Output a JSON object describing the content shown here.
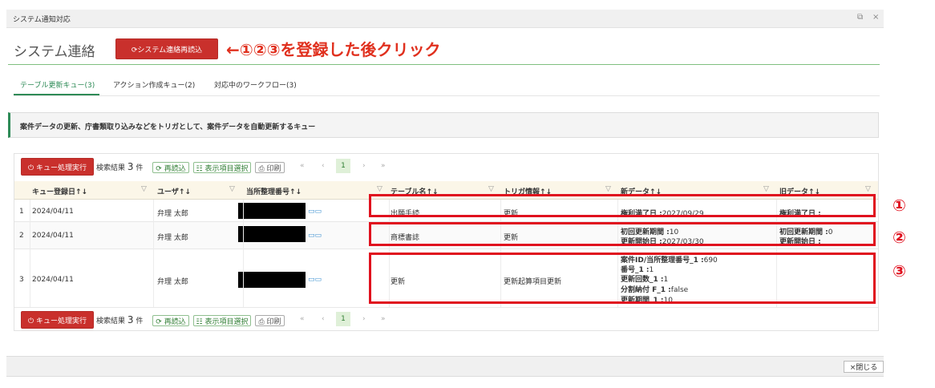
{
  "window": {
    "title": "システム通知対応",
    "icons": [
      "restore-icon",
      "close-icon"
    ],
    "restore_glyph": "⧉",
    "close_glyph": "×"
  },
  "header": {
    "title": "システム連絡",
    "reload_button": "⟳システム連絡再読込",
    "annotation": "←①②③を登録した後クリック"
  },
  "tabs": [
    {
      "label": "テーブル更新キュー(3)",
      "active": true
    },
    {
      "label": "アクション作成キュー(2)",
      "active": false
    },
    {
      "label": "対応中のワークフロー(3)",
      "active": false
    }
  ],
  "description": "案件データの更新、庁書類取り込みなどをトリガとして、案件データを自動更新するキュー",
  "toolbar": {
    "execute": "⏻ キュー処理実行",
    "result_prefix": "検索結果",
    "result_count": "3",
    "result_suffix": "件",
    "reload": "⟳ 再読込",
    "columns": "☷ 表示項目選択",
    "print": "⎙ 印刷",
    "pager": {
      "first": "«",
      "prev": "‹",
      "current": "1",
      "next": "›",
      "last": "»"
    }
  },
  "table": {
    "columns": [
      "キュー登録日↑↓",
      "ユーザ↑↓",
      "当所整理番号↑↓",
      "テーブル名↑↓",
      "トリガ情報↑↓",
      "新データ↑↓",
      "旧データ↑↓"
    ],
    "filter_glyph": "▽",
    "attach_glyph": "▭▭",
    "rows": [
      {
        "no": "1",
        "date": "2024/04/11",
        "user": "弁理 太郎",
        "table": "出願手続",
        "trigger": "更新",
        "new": [
          {
            "k": "権利満了日 :",
            "v": "2027/09/29"
          }
        ],
        "old": [
          {
            "k": "権利満了日 :",
            "v": ""
          }
        ]
      },
      {
        "no": "2",
        "date": "2024/04/11",
        "user": "弁理 太郎",
        "table": "商標書誌",
        "trigger": "更新",
        "new": [
          {
            "k": "初回更新期間 :",
            "v": "10"
          },
          {
            "k": "更新開始日 :",
            "v": "2027/03/30"
          }
        ],
        "old": [
          {
            "k": "初回更新期間 :",
            "v": "0"
          },
          {
            "k": "更新開始日 :",
            "v": ""
          }
        ]
      },
      {
        "no": "3",
        "date": "2024/04/11",
        "user": "弁理 太郎",
        "table": "更新",
        "trigger": "更新起算項目更新",
        "new": [
          {
            "k": "案件ID/当所整理番号_1 :",
            "v": "690"
          },
          {
            "k": "番号_1 :",
            "v": "1"
          },
          {
            "k": "更新回数_1 :",
            "v": "1"
          },
          {
            "k": "分割納付 F_1 :",
            "v": "false"
          },
          {
            "k": "更新期間_1 :",
            "v": "10"
          }
        ],
        "old": []
      }
    ]
  },
  "annotations": [
    "①",
    "②",
    "③"
  ],
  "footer": {
    "close": "×閉じる"
  },
  "colors": {
    "accent_green": "#2e8b57",
    "danger_red": "#c9302c",
    "annotation_red": "#e0101e"
  }
}
